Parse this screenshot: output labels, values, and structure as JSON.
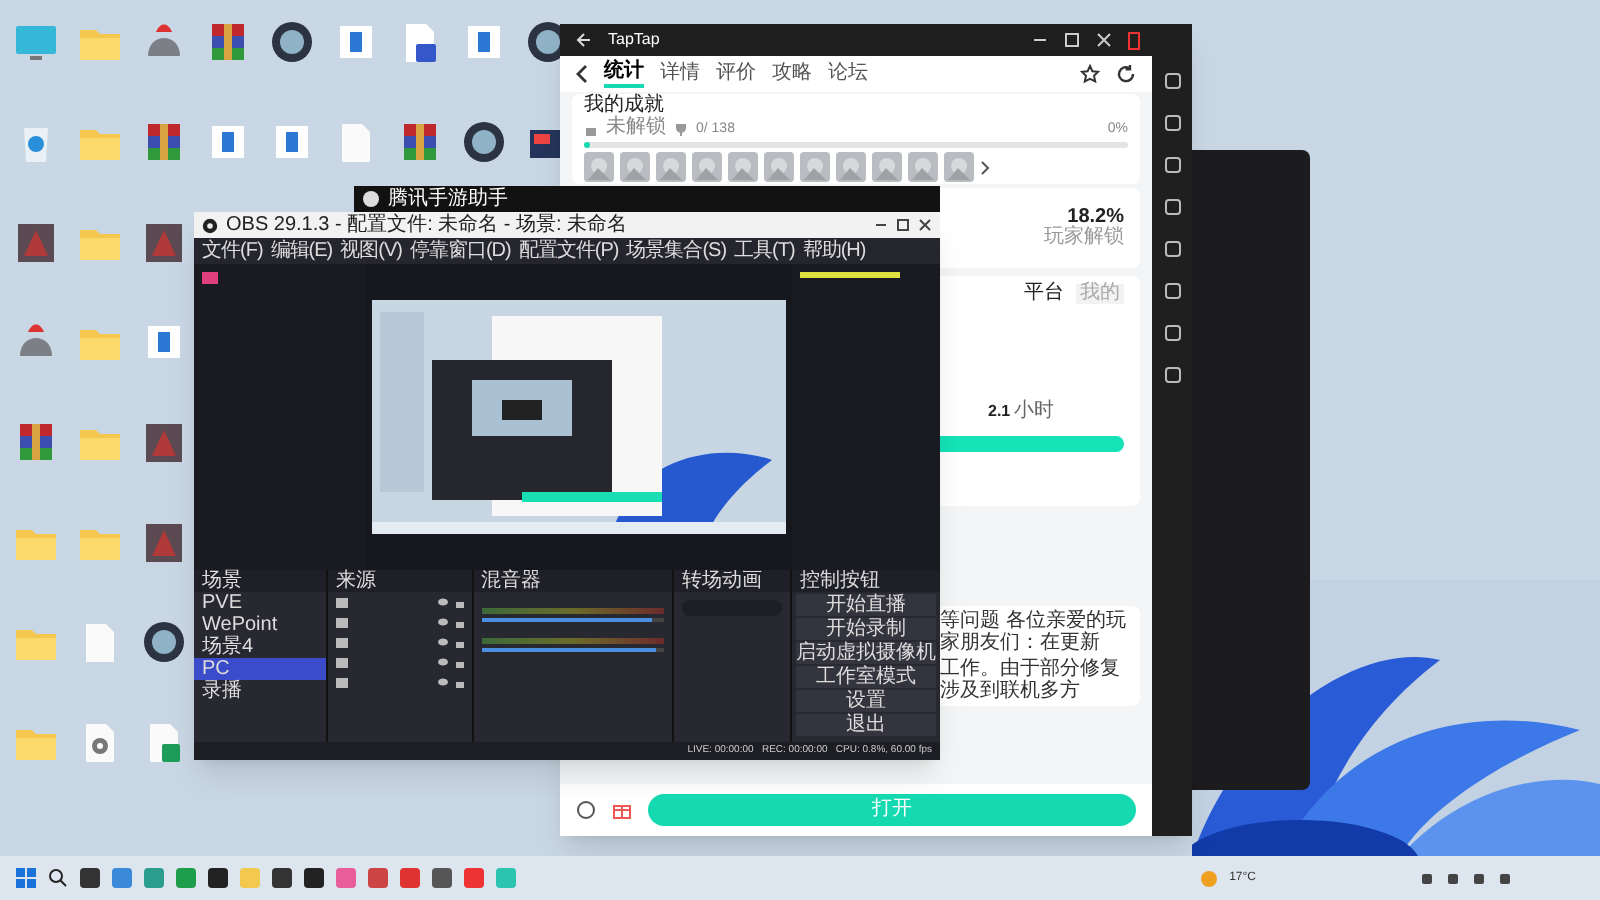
{
  "desktop": {
    "rows": [
      [
        {
          "kind": "monitor"
        },
        {
          "kind": "folder"
        },
        {
          "kind": "helmet"
        },
        {
          "kind": "archive"
        },
        {
          "kind": "trainer"
        },
        {
          "kind": "doc"
        },
        {
          "kind": "word"
        },
        {
          "kind": "doc"
        },
        {
          "kind": "trainer"
        }
      ],
      [
        {
          "kind": "recycle"
        },
        {
          "kind": "folder"
        },
        {
          "kind": "archive"
        },
        {
          "kind": "doc"
        },
        {
          "kind": "doc"
        },
        {
          "kind": "file"
        },
        {
          "kind": "archive"
        },
        {
          "kind": "trainer"
        },
        {
          "kind": "app"
        }
      ],
      [
        {
          "kind": "game"
        },
        {
          "kind": "folder"
        },
        {
          "kind": "game"
        }
      ],
      [
        {
          "kind": "helmet"
        },
        {
          "kind": "folder"
        },
        {
          "kind": "doc"
        }
      ],
      [
        {
          "kind": "archive"
        },
        {
          "kind": "folder"
        },
        {
          "kind": "game"
        }
      ],
      [
        {
          "kind": "folder"
        },
        {
          "kind": "folder"
        },
        {
          "kind": "game"
        }
      ],
      [
        {
          "kind": "folder"
        },
        {
          "kind": "file"
        },
        {
          "kind": "trainer"
        }
      ],
      [
        {
          "kind": "folder"
        },
        {
          "kind": "settings"
        },
        {
          "kind": "sheet"
        }
      ]
    ]
  },
  "helper_bar": {
    "title": "腾讯手游助手"
  },
  "taptap": {
    "title": "TapTap",
    "tabs": [
      {
        "label": "统计",
        "selected": true
      },
      {
        "label": "详情",
        "selected": false
      },
      {
        "label": "评价",
        "selected": false
      },
      {
        "label": "攻略",
        "selected": false
      },
      {
        "label": "论坛",
        "selected": false
      }
    ],
    "achievements": {
      "title": "我的成就",
      "status": "未解锁",
      "count": "0/ 138",
      "percent": "0%",
      "level": 0.0
    },
    "unlock_rate": {
      "value": "18.2%",
      "label": "玩家解锁"
    },
    "filter": [
      {
        "label": "平台",
        "selected": true
      },
      {
        "label": "我的",
        "selected": false
      }
    ],
    "playtime": {
      "value": "2.1",
      "unit": "小时"
    },
    "notice": [
      "等问题 各位亲爱的玩家朋友们：在更新",
      "工作。由于部分修复涉及到联机多方"
    ],
    "open_button": "打开"
  },
  "obs": {
    "title": "OBS 29.1.3 - 配置文件: 未命名 - 场景: 未命名",
    "menu": [
      "文件(F)",
      "编辑(E)",
      "视图(V)",
      "停靠窗口(D)",
      "配置文件(P)",
      "场景集合(S)",
      "工具(T)",
      "帮助(H)"
    ],
    "docks": [
      "场景",
      "来源",
      "混音器",
      "转场动画",
      "控制按钮"
    ],
    "scenes": [
      {
        "label": "PVE",
        "selected": false
      },
      {
        "label": "WePoint",
        "selected": false
      },
      {
        "label": "场景4",
        "selected": false
      },
      {
        "label": "PC",
        "selected": true
      },
      {
        "label": "录播",
        "selected": false
      }
    ],
    "mixer": [
      {
        "level": 0.93
      },
      {
        "level": 0.95
      }
    ],
    "controls": [
      "开始直播",
      "开始录制",
      "启动虚拟摄像机",
      "工作室模式",
      "设置",
      "退出"
    ],
    "status": "LIVE: 00:00:00   REC: 00:00:00   CPU: 0.8%, 60.00 fps"
  },
  "taskbar": {
    "weather": "17°C"
  }
}
